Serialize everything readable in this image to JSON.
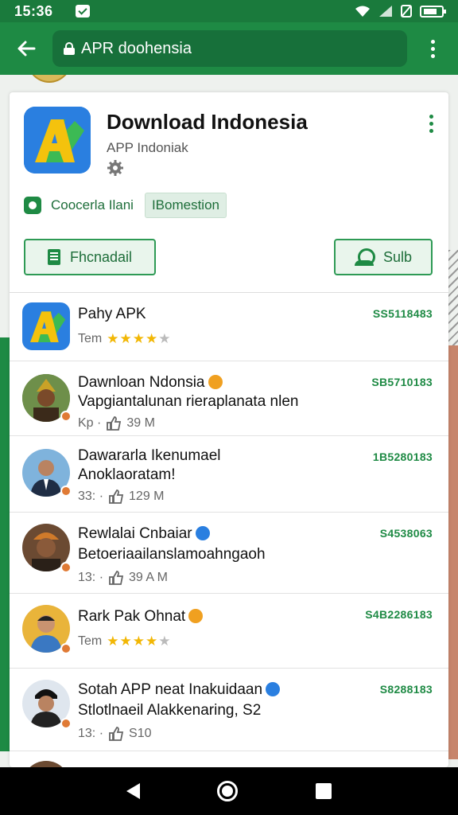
{
  "status_bar": {
    "time": "15:36"
  },
  "toolbar": {
    "url": "APR doohensia"
  },
  "app": {
    "title": "Download Indonesia",
    "subtitle": "APP Indoniak",
    "tag_label": "Coocerla Ilani",
    "tag_chip": "IBomestion",
    "download_button": "Fhcnadail",
    "sub_button": "Sulb"
  },
  "items": [
    {
      "title": "Pahy APK",
      "meta": "Tem",
      "rating": 4,
      "count": "SS5118483"
    },
    {
      "title": "Dawnloan Ndonsia",
      "desc": "Vapgiantalunan rieraplanata nlen",
      "meta_prefix": "Kp ·",
      "meta": "39 M",
      "count": "SB5710183"
    },
    {
      "title": "Dawararla Ikenumael",
      "desc": "Anoklaoratam!",
      "meta_prefix": "33: ·",
      "meta": "129 M",
      "count": "1B5280183"
    },
    {
      "title": "Rewlalai Cnbaiar",
      "desc": "Betoeriaailanslamoahngaoh",
      "meta_prefix": "13: ·",
      "meta": "39 A M",
      "count": "S4538063"
    },
    {
      "title": "Rark Pak Ohnat",
      "meta": "Tem",
      "rating": 4,
      "count": "S4B2286183"
    },
    {
      "title": "Sotah APP neat Inakuidaan",
      "desc": "Stlotlnaeil Alakkenaring, S2",
      "meta_prefix": "13: ·",
      "meta": "S10",
      "count": "S8288183"
    }
  ],
  "colors": {
    "primary": "#1e8a44",
    "status": "#1a7a3c",
    "accent_star": "#f2b705"
  }
}
